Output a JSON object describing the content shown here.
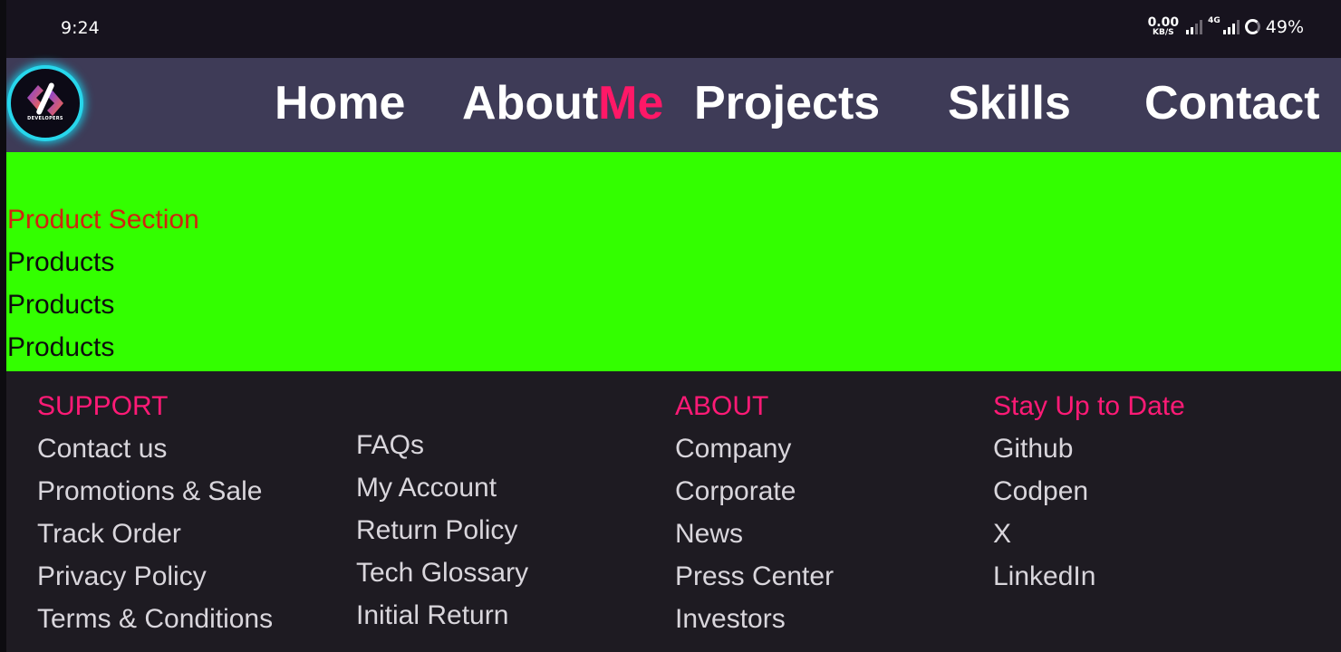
{
  "status_bar": {
    "time": "9:24",
    "net_speed_value": "0.00",
    "net_speed_unit": "KB/S",
    "network_type": "4G",
    "battery": "49%"
  },
  "nav": {
    "links": [
      {
        "label": "Home"
      },
      {
        "label": "About",
        "accent": "Me"
      },
      {
        "label": "Projects"
      },
      {
        "label": "Skills"
      },
      {
        "label": "Contact"
      }
    ],
    "logo_text": "DEVELOPERS"
  },
  "products": {
    "title": "Product Section",
    "items": [
      "Products",
      "Products",
      "Products"
    ]
  },
  "footer": {
    "support": {
      "heading": "SUPPORT",
      "links": [
        "Contact us",
        "Promotions & Sale",
        "Track Order",
        "Privacy Policy",
        "Terms & Conditions"
      ]
    },
    "help": {
      "links": [
        "FAQs",
        "My Account",
        "Return Policy",
        "Tech Glossary",
        "Initial Return"
      ]
    },
    "about": {
      "heading": "ABOUT",
      "links": [
        "Company",
        "Corporate",
        "News",
        "Press Center",
        "Investors"
      ]
    },
    "social": {
      "heading": "Stay Up to Date",
      "links": [
        "Github",
        "Codpen",
        "X",
        "LinkedIn"
      ]
    }
  },
  "colors": {
    "nav_bg": "#3e3b57",
    "accent": "#ff1867",
    "product_bg": "#33ff00",
    "product_title": "#d0240f",
    "footer_bg": "#1e1b22"
  }
}
